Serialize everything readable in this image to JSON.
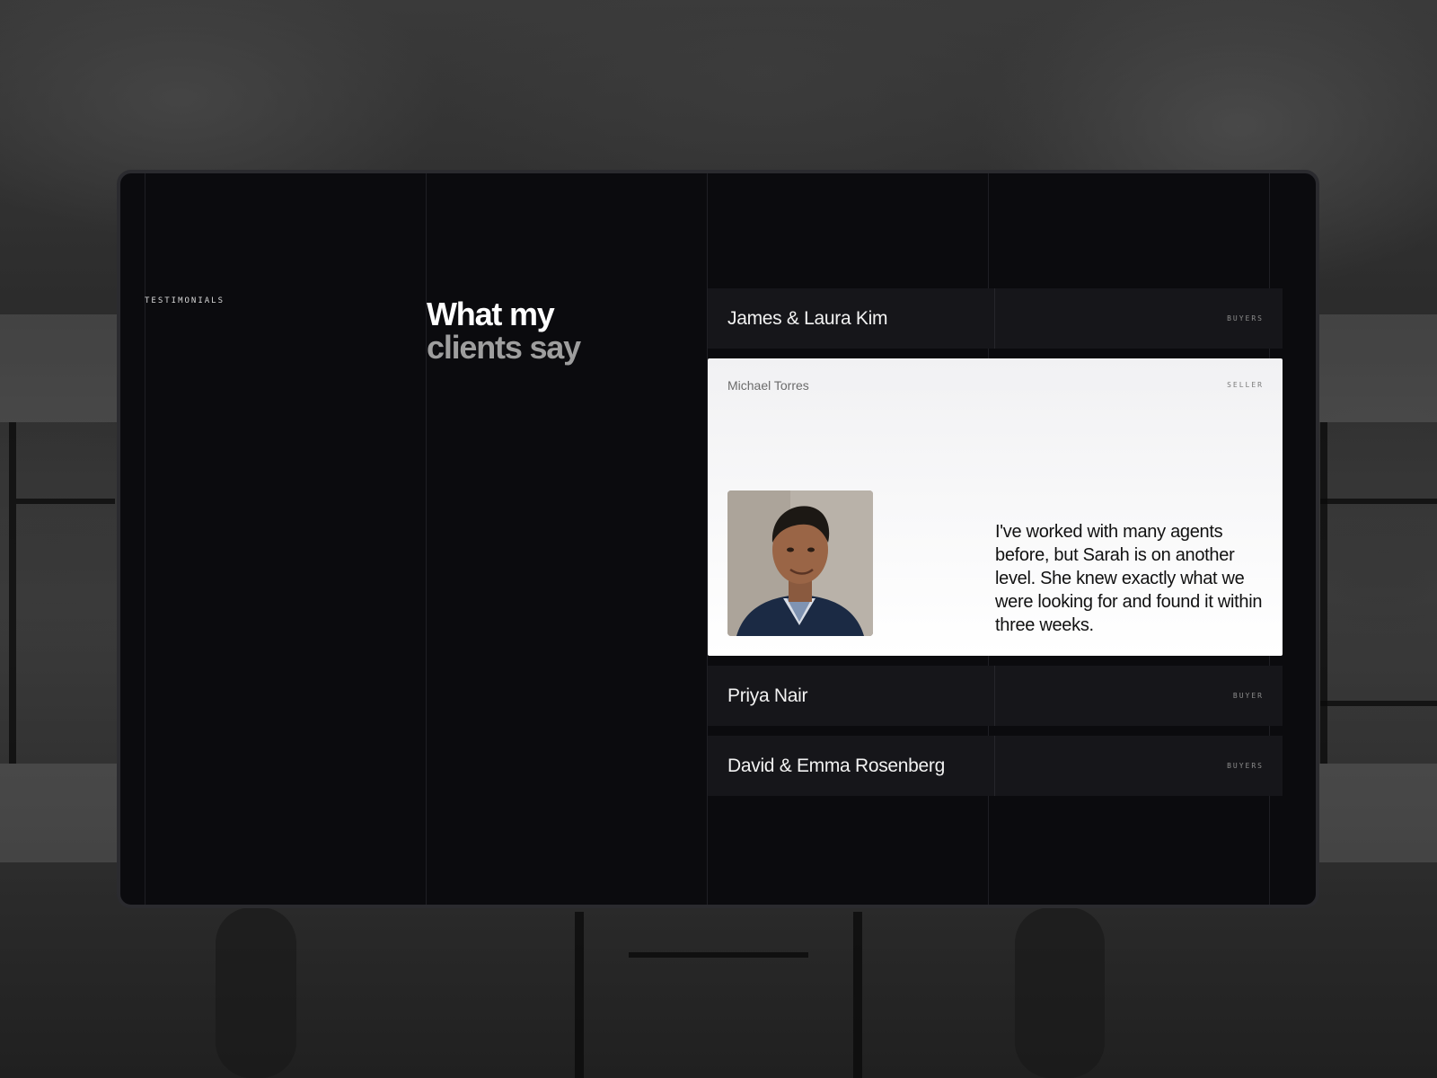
{
  "section": {
    "eyebrow": "TESTIMONIALS",
    "heading_line1": "What my",
    "heading_line2": "clients say"
  },
  "testimonials": [
    {
      "name": "James & Laura Kim",
      "role": "BUYERS"
    },
    {
      "name": "Michael Torres",
      "role": "SELLER",
      "quote": "I've worked with many agents before, but Sarah is on another level. She knew exactly what we were looking for and found it within three weeks.",
      "active": true
    },
    {
      "name": "Priya Nair",
      "role": "BUYER"
    },
    {
      "name": "David & Emma Rosenberg",
      "role": "BUYERS"
    }
  ],
  "colors": {
    "panel_bg": "#0b0b0e",
    "item_bg": "#16161a",
    "active_bg": "#ffffff",
    "heading_primary": "#ffffff",
    "heading_muted": "#9e9e9e"
  }
}
